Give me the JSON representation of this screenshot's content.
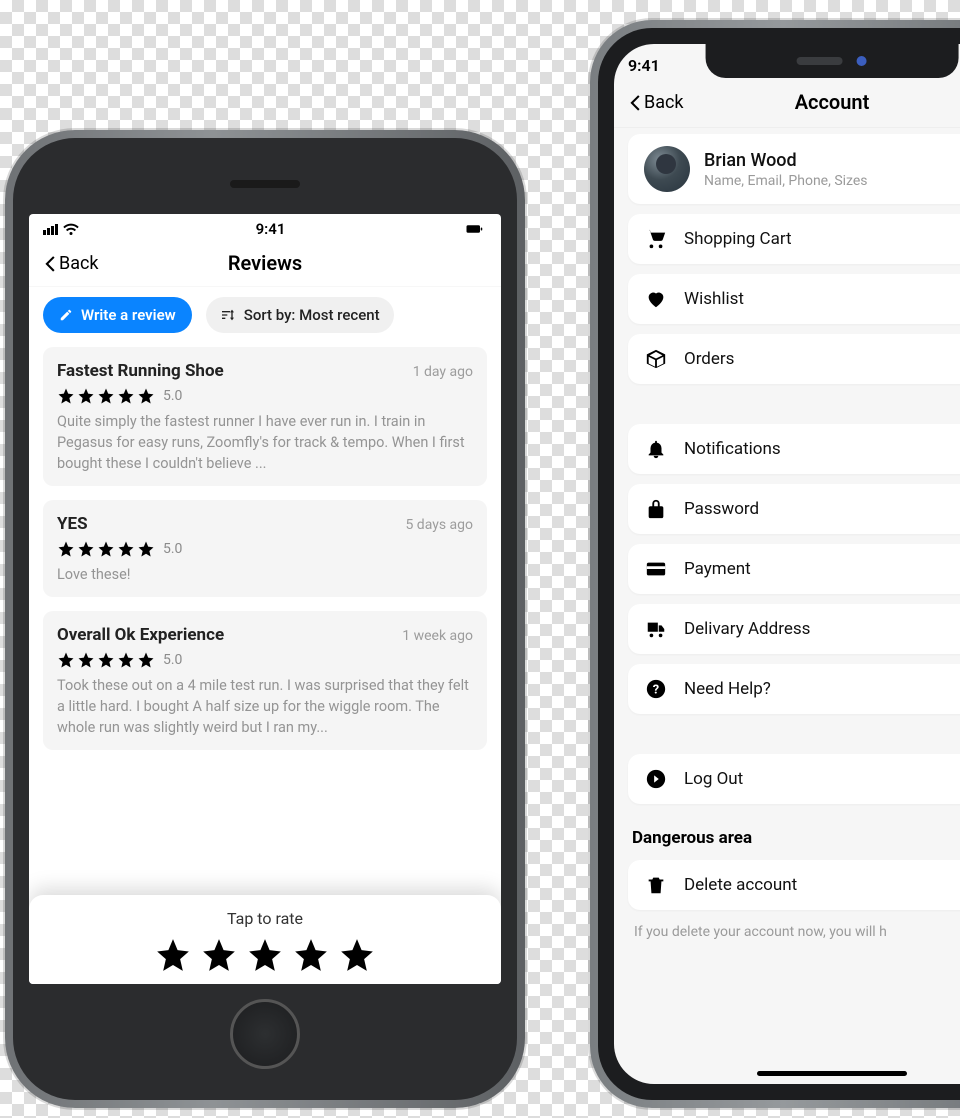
{
  "status_time": "9:41",
  "back_label": "Back",
  "phone1": {
    "title": "Reviews",
    "write_review": "Write a review",
    "sort_label": "Sort by: Most recent",
    "tap_to_rate": "Tap to rate",
    "reviews": [
      {
        "title": "Fastest Running Shoe",
        "time": "1 day ago",
        "rating": "5.0",
        "body": "Quite simply the fastest runner I have ever run in. I train in Pegasus for easy runs, Zoomfly's for track & tempo. When I first bought these I couldn't believe ..."
      },
      {
        "title": "YES",
        "time": "5 days ago",
        "rating": "5.0",
        "body": "Love these!"
      },
      {
        "title": "Overall Ok Experience",
        "time": "1 week ago",
        "rating": "5.0",
        "body": "Took these out on a 4 mile test run. I was surprised that they felt a little hard. I bought A half size up for the wiggle room. The whole run was slightly weird but I ran my..."
      }
    ]
  },
  "phone2": {
    "title": "Account",
    "profile_name": "Brian Wood",
    "profile_sub": "Name, Email, Phone, Sizes",
    "items": [
      {
        "icon": "cart",
        "label": "Shopping Cart"
      },
      {
        "icon": "heart",
        "label": "Wishlist"
      },
      {
        "icon": "box",
        "label": "Orders"
      }
    ],
    "items2": [
      {
        "icon": "bell",
        "label": "Notifications"
      },
      {
        "icon": "lock",
        "label": "Password"
      },
      {
        "icon": "card",
        "label": "Payment"
      },
      {
        "icon": "truck",
        "label": "Delivary Address"
      },
      {
        "icon": "help",
        "label": "Need Help?"
      }
    ],
    "items3": [
      {
        "icon": "logout",
        "label": "Log Out"
      }
    ],
    "danger_label": "Dangerous area",
    "delete_label": "Delete account",
    "delete_sub": "If you delete your account now, you will h"
  }
}
